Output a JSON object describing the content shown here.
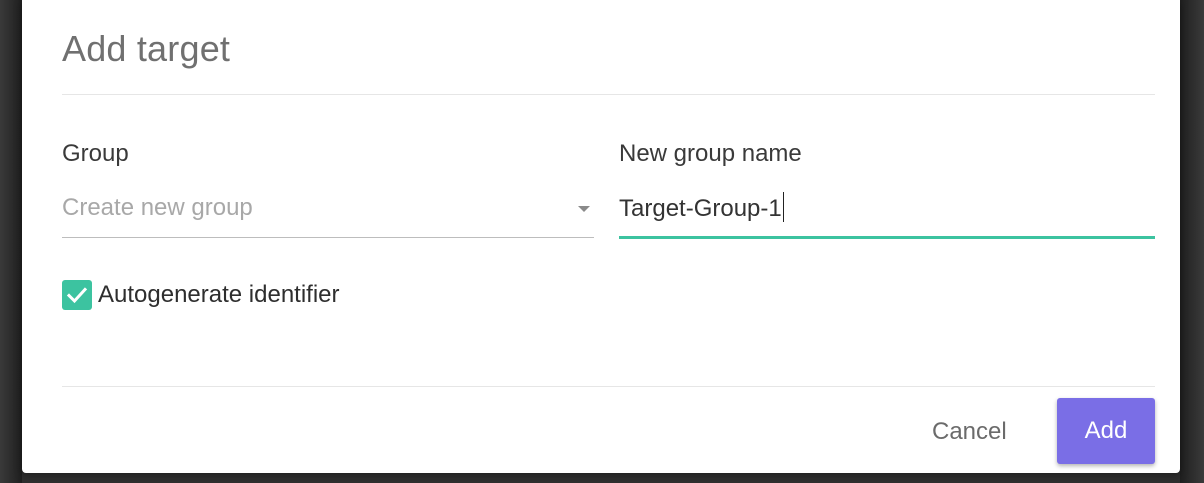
{
  "dialog": {
    "title": "Add target"
  },
  "form": {
    "group": {
      "label": "Group",
      "selected_value": "Create new group"
    },
    "new_group_name": {
      "label": "New group name",
      "value": "Target-Group-1"
    },
    "autogenerate": {
      "label": "Autogenerate identifier",
      "checked": true
    }
  },
  "actions": {
    "cancel_label": "Cancel",
    "add_label": "Add"
  },
  "icons": {
    "select_caret": "caret-down-icon",
    "checkbox_check": "check-icon"
  },
  "colors": {
    "accent": "#3cc3a0",
    "primary_button": "#7a6ee6"
  }
}
